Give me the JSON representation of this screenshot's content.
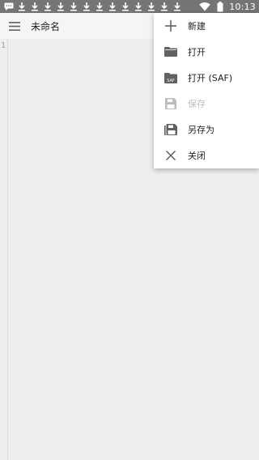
{
  "status_bar": {
    "time": "10:13",
    "notification_icons": [
      "message-icon",
      "download-icon",
      "download-icon",
      "download-icon",
      "download-icon",
      "download-icon",
      "download-icon",
      "download-icon",
      "download-icon",
      "download-icon",
      "download-icon",
      "download-icon",
      "download-icon"
    ],
    "system_icons": [
      "wifi-icon",
      "battery-icon"
    ]
  },
  "toolbar": {
    "menu_icon": "hamburger-icon",
    "title": "未命名"
  },
  "editor": {
    "line_numbers": [
      "1"
    ]
  },
  "popup_menu": {
    "items": [
      {
        "label": "新建",
        "icon": "plus-icon",
        "enabled": true
      },
      {
        "label": "打开",
        "icon": "folder-open-icon",
        "enabled": true
      },
      {
        "label": "打开 (SAF)",
        "icon": "folder-saf-icon",
        "enabled": true
      },
      {
        "label": "保存",
        "icon": "save-icon",
        "enabled": false
      },
      {
        "label": "另存为",
        "icon": "save-as-icon",
        "enabled": true
      },
      {
        "label": "关闭",
        "icon": "close-icon",
        "enabled": true
      }
    ]
  },
  "colors": {
    "status_bar": "#757575",
    "toolbar": "#f5f5f5",
    "editor_bg": "#eeeeee",
    "icon": "#616161",
    "disabled": "#bdbdbd"
  }
}
